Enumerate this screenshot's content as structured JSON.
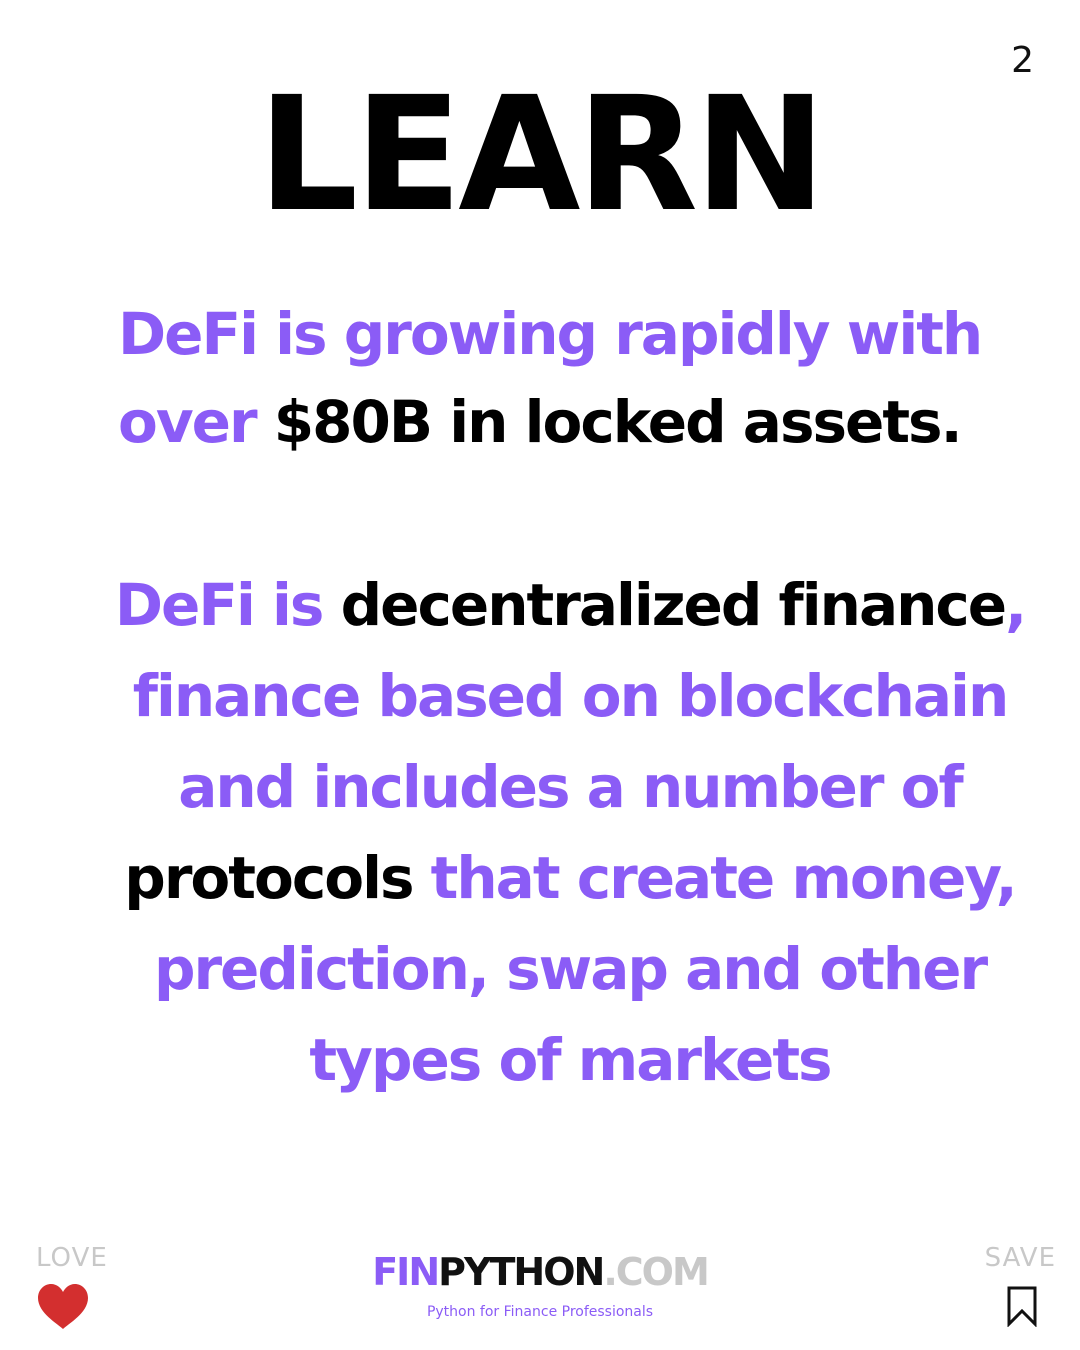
{
  "page_number": "2",
  "heading": "LEARN",
  "paragraph1": {
    "part1": "DeFi is growing rapidly with over ",
    "part2": "$80B in locked assets."
  },
  "paragraph2": {
    "part1": "DeFi is ",
    "part2": "decentralized finance",
    "part3": ", finance based on blockchain and includes a number of ",
    "part4": "protocols",
    "part5": " that create money, prediction, swap and other types of markets"
  },
  "footer": {
    "love_label": "LOVE",
    "save_label": "SAVE",
    "brand_fin": "FIN",
    "brand_python": "PYTHON",
    "brand_com": ".COM",
    "tagline": "Python for Finance Professionals"
  },
  "icons": {
    "heart": "heart-icon",
    "bookmark": "bookmark-icon"
  },
  "colors": {
    "accent": "#8b5cf6",
    "text": "#000000",
    "muted": "#c8c8c8",
    "heart": "#d32f2f"
  }
}
